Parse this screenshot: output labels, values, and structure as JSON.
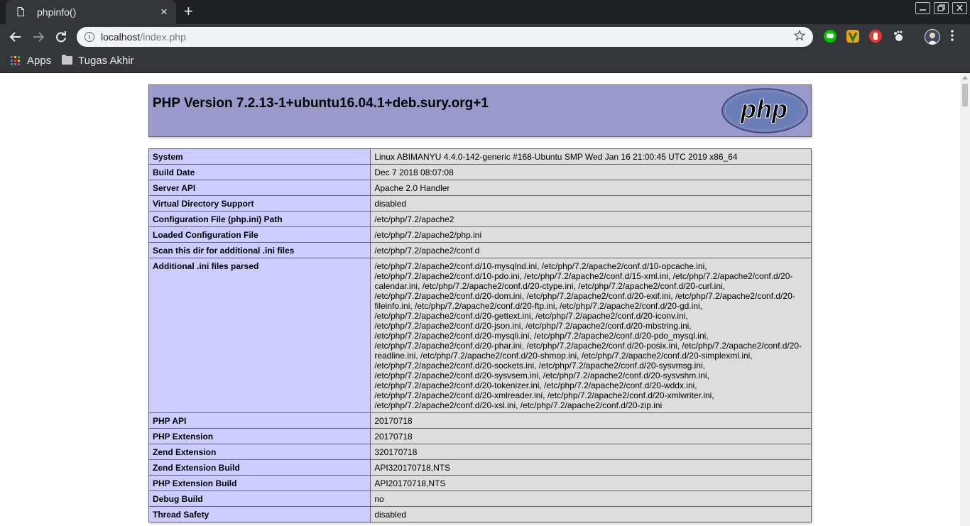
{
  "browser": {
    "tab_title": "phpinfo()",
    "tab_close": "×",
    "new_tab": "+",
    "url_host": "localhost",
    "url_path": "/index.php",
    "bookmarks": [
      {
        "label": "Apps",
        "icon": "apps-grid-icon"
      },
      {
        "label": "Tugas Akhir",
        "icon": "folder-icon"
      }
    ],
    "extensions": [
      {
        "name": "line-extension-icon",
        "color": "#00c300"
      },
      {
        "name": "vimium-extension-icon",
        "color": "#e8a317"
      },
      {
        "name": "stop-hand-extension-icon",
        "color": "#e53935"
      },
      {
        "name": "gnome-extension-icon",
        "color": "#e8eaed"
      }
    ]
  },
  "phpinfo": {
    "title": "PHP Version 7.2.13-1+ubuntu16.04.1+deb.sury.org+1",
    "logo_text": "php",
    "rows": [
      {
        "key": "System",
        "value": "Linux ABIMANYU 4.4.0-142-generic #168-Ubuntu SMP Wed Jan 16 21:00:45 UTC 2019 x86_64"
      },
      {
        "key": "Build Date",
        "value": "Dec 7 2018 08:07:08"
      },
      {
        "key": "Server API",
        "value": "Apache 2.0 Handler"
      },
      {
        "key": "Virtual Directory Support",
        "value": "disabled"
      },
      {
        "key": "Configuration File (php.ini) Path",
        "value": "/etc/php/7.2/apache2"
      },
      {
        "key": "Loaded Configuration File",
        "value": "/etc/php/7.2/apache2/php.ini"
      },
      {
        "key": "Scan this dir for additional .ini files",
        "value": "/etc/php/7.2/apache2/conf.d"
      },
      {
        "key": "Additional .ini files parsed",
        "value": "/etc/php/7.2/apache2/conf.d/10-mysqlnd.ini, /etc/php/7.2/apache2/conf.d/10-opcache.ini, /etc/php/7.2/apache2/conf.d/10-pdo.ini, /etc/php/7.2/apache2/conf.d/15-xml.ini, /etc/php/7.2/apache2/conf.d/20-calendar.ini, /etc/php/7.2/apache2/conf.d/20-ctype.ini, /etc/php/7.2/apache2/conf.d/20-curl.ini, /etc/php/7.2/apache2/conf.d/20-dom.ini, /etc/php/7.2/apache2/conf.d/20-exif.ini, /etc/php/7.2/apache2/conf.d/20-fileinfo.ini, /etc/php/7.2/apache2/conf.d/20-ftp.ini, /etc/php/7.2/apache2/conf.d/20-gd.ini, /etc/php/7.2/apache2/conf.d/20-gettext.ini, /etc/php/7.2/apache2/conf.d/20-iconv.ini, /etc/php/7.2/apache2/conf.d/20-json.ini, /etc/php/7.2/apache2/conf.d/20-mbstring.ini, /etc/php/7.2/apache2/conf.d/20-mysqli.ini, /etc/php/7.2/apache2/conf.d/20-pdo_mysql.ini, /etc/php/7.2/apache2/conf.d/20-phar.ini, /etc/php/7.2/apache2/conf.d/20-posix.ini, /etc/php/7.2/apache2/conf.d/20-readline.ini, /etc/php/7.2/apache2/conf.d/20-shmop.ini, /etc/php/7.2/apache2/conf.d/20-simplexml.ini, /etc/php/7.2/apache2/conf.d/20-sockets.ini, /etc/php/7.2/apache2/conf.d/20-sysvmsg.ini, /etc/php/7.2/apache2/conf.d/20-sysvsem.ini, /etc/php/7.2/apache2/conf.d/20-sysvshm.ini, /etc/php/7.2/apache2/conf.d/20-tokenizer.ini, /etc/php/7.2/apache2/conf.d/20-wddx.ini, /etc/php/7.2/apache2/conf.d/20-xmlreader.ini, /etc/php/7.2/apache2/conf.d/20-xmlwriter.ini, /etc/php/7.2/apache2/conf.d/20-xsl.ini, /etc/php/7.2/apache2/conf.d/20-zip.ini"
      },
      {
        "key": "PHP API",
        "value": "20170718"
      },
      {
        "key": "PHP Extension",
        "value": "20170718"
      },
      {
        "key": "Zend Extension",
        "value": "320170718"
      },
      {
        "key": "Zend Extension Build",
        "value": "API320170718,NTS"
      },
      {
        "key": "PHP Extension Build",
        "value": "API20170718,NTS"
      },
      {
        "key": "Debug Build",
        "value": "no"
      },
      {
        "key": "Thread Safety",
        "value": "disabled"
      }
    ]
  },
  "colors": {
    "header_bg": "#9999cc",
    "key_cell_bg": "#ccccff",
    "value_cell_bg": "#dddddd",
    "border": "#666666"
  }
}
